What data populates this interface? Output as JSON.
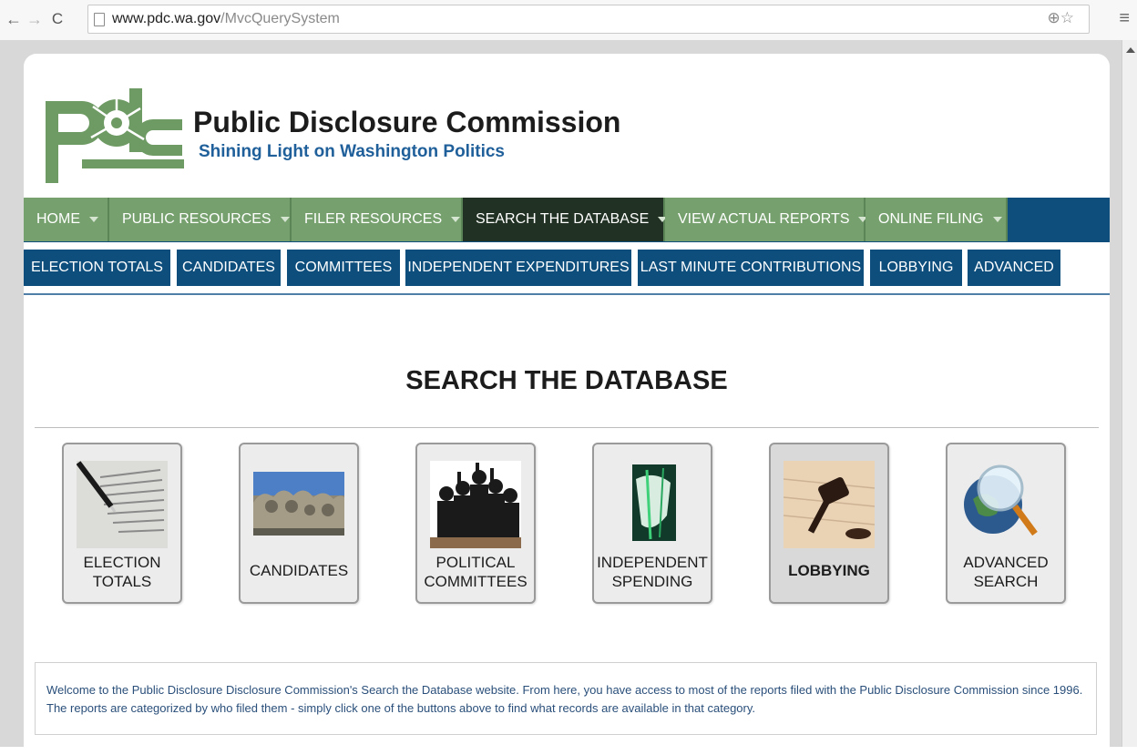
{
  "browser": {
    "url_host": "www.pdc.wa.gov",
    "url_path": "/MvcQuerySystem"
  },
  "header": {
    "title": "Public Disclosure Commission",
    "tagline": "Shining Light on Washington Politics"
  },
  "primary_nav": [
    {
      "label": "HOME"
    },
    {
      "label": "PUBLIC RESOURCES"
    },
    {
      "label": "FILER RESOURCES"
    },
    {
      "label": "SEARCH THE DATABASE",
      "active": true
    },
    {
      "label": "VIEW ACTUAL REPORTS"
    },
    {
      "label": "ONLINE FILING"
    }
  ],
  "secondary_nav": [
    {
      "label": "ELECTION TOTALS"
    },
    {
      "label": "CANDIDATES"
    },
    {
      "label": "COMMITTEES"
    },
    {
      "label": "INDEPENDENT EXPENDITURES"
    },
    {
      "label": "LAST MINUTE CONTRIBUTIONS"
    },
    {
      "label": "LOBBYING"
    },
    {
      "label": "ADVANCED"
    }
  ],
  "main": {
    "heading": "SEARCH THE DATABASE",
    "cards": [
      {
        "label": "ELECTION\nTOTALS"
      },
      {
        "label": "CANDIDATES"
      },
      {
        "label": "POLITICAL\nCOMMITTEES"
      },
      {
        "label": "INDEPENDENT\nSPENDING"
      },
      {
        "label": "LOBBYING"
      },
      {
        "label": "ADVANCED\nSEARCH"
      }
    ],
    "welcome_text": "Welcome to the Public Disclosure Disclosure Commission's Search the Database website. From here, you have access to most of the reports filed with the Public Disclosure Commission since 1996. The reports are categorized by who filed them - simply click one of the buttons above to find what records are available in that category."
  },
  "colors": {
    "nav_green": "#76a16e",
    "nav_active": "#213123",
    "nav_blue": "#0d4e7d",
    "tagline_blue": "#1f5f9a",
    "logo_green": "#6e9a63"
  }
}
